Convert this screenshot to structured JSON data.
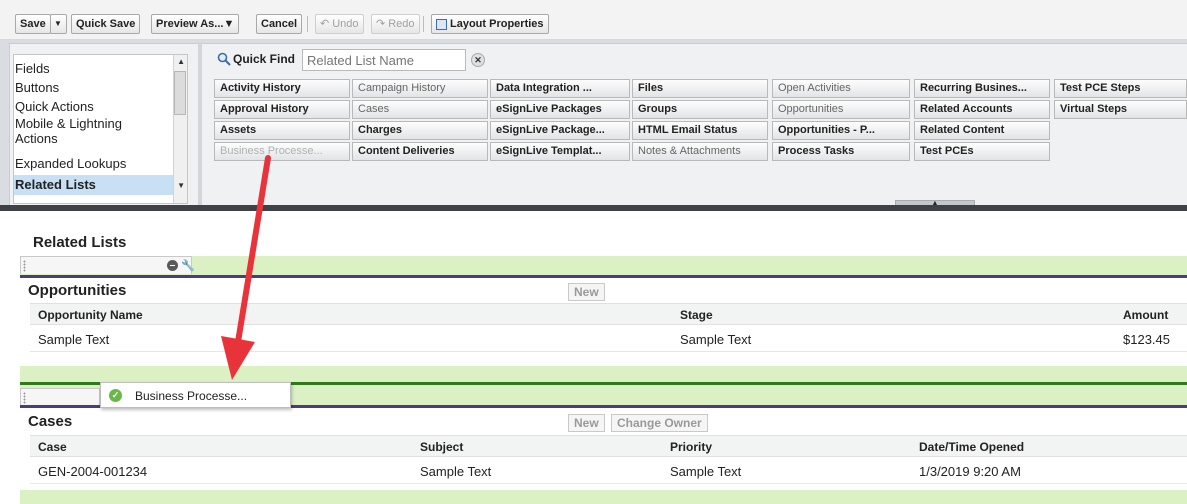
{
  "toolbar": {
    "save": "Save",
    "save_menu": "▼",
    "quick_save": "Quick Save",
    "preview_as": "Preview As...▼",
    "cancel": "Cancel",
    "undo": "Undo",
    "redo": "Redo",
    "layout_properties": "Layout Properties"
  },
  "palette": {
    "categories": [
      "Fields",
      "Buttons",
      "Quick Actions",
      "Mobile & Lightning",
      "Actions",
      "Expanded Lookups",
      "Related Lists"
    ],
    "selected_category": "Related Lists",
    "quick_find_label": "Quick Find",
    "quick_find_placeholder": "Related List Name",
    "items": {
      "activity_history": "Activity History",
      "approval_history": "Approval History",
      "assets": "Assets",
      "business_processes": "Business Processe...",
      "campaign_history": "Campaign History",
      "cases": "Cases",
      "charges": "Charges",
      "content_deliveries": "Content Deliveries",
      "data_integration": "Data Integration ...",
      "esignlive_packages": "eSignLive Packages",
      "esignlive_package": "eSignLive Package...",
      "esignlive_templat": "eSignLive Templat...",
      "files": "Files",
      "groups": "Groups",
      "html_email_status": "HTML Email Status",
      "notes_attachments": "Notes & Attachments",
      "open_activities": "Open Activities",
      "opportunities": "Opportunities",
      "opportunities_p": "Opportunities - P...",
      "process_tasks": "Process Tasks",
      "recurring_business": "Recurring Busines...",
      "related_accounts": "Related Accounts",
      "related_content": "Related Content",
      "test_pces": "Test PCEs",
      "test_pce_steps": "Test PCE Steps",
      "virtual_steps": "Virtual Steps"
    }
  },
  "layout": {
    "section_title": "Related Lists",
    "opportunities": {
      "title": "Opportunities",
      "new_button": "New",
      "columns": [
        "Opportunity Name",
        "Stage",
        "Amount"
      ],
      "row": [
        "Sample Text",
        "Sample Text",
        "$123.45"
      ]
    },
    "drag_item": "Business Processe...",
    "cases": {
      "title": "Cases",
      "new_button": "New",
      "change_owner_button": "Change Owner",
      "columns": [
        "Case",
        "Subject",
        "Priority",
        "Date/Time Opened"
      ],
      "row": [
        "GEN-2004-001234",
        "Sample Text",
        "Sample Text",
        "1/3/2019 9:20 AM"
      ]
    }
  },
  "colors": {
    "annotation_arrow": "#e8333a",
    "related_list_band": "#dbf1c4",
    "related_list_rule": "#4a3d7a",
    "selected_category": "#c8e0f4"
  }
}
